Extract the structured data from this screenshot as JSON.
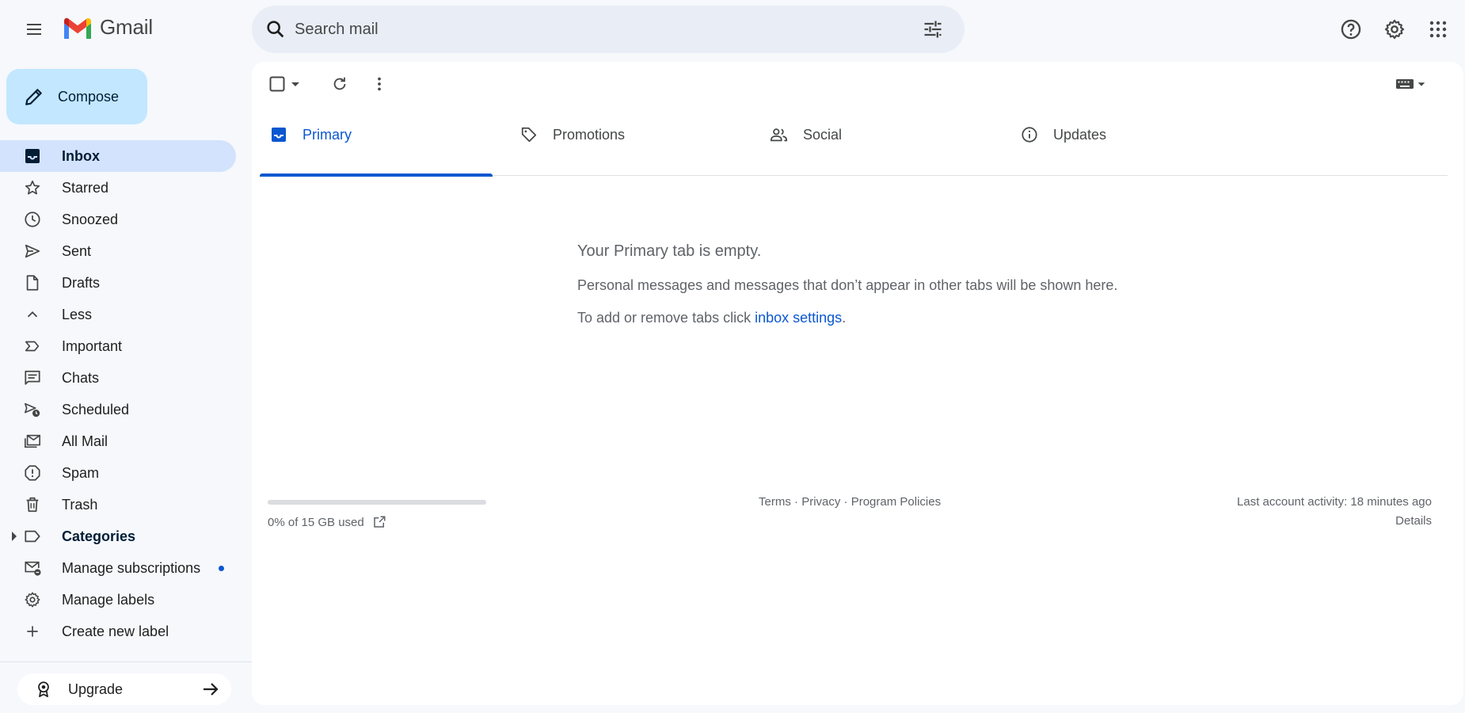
{
  "header": {
    "app_name": "Gmail",
    "search": {
      "placeholder": "Search mail"
    }
  },
  "sidebar": {
    "compose_label": "Compose",
    "items": [
      {
        "label": "Inbox",
        "icon": "inbox-icon",
        "active": true
      },
      {
        "label": "Starred",
        "icon": "star-icon"
      },
      {
        "label": "Snoozed",
        "icon": "clock-icon"
      },
      {
        "label": "Sent",
        "icon": "send-icon"
      },
      {
        "label": "Drafts",
        "icon": "draft-icon"
      },
      {
        "label": "Less",
        "icon": "chevron-up-icon"
      },
      {
        "label": "Important",
        "icon": "important-icon"
      },
      {
        "label": "Chats",
        "icon": "chat-icon"
      },
      {
        "label": "Scheduled",
        "icon": "scheduled-icon"
      },
      {
        "label": "All Mail",
        "icon": "all-mail-icon"
      },
      {
        "label": "Spam",
        "icon": "spam-icon"
      },
      {
        "label": "Trash",
        "icon": "trash-icon"
      },
      {
        "label": "Categories",
        "icon": "label-icon",
        "bold": true
      },
      {
        "label": "Manage subscriptions",
        "icon": "subscriptions-icon"
      },
      {
        "label": "Manage labels",
        "icon": "gear-icon"
      },
      {
        "label": "Create new label",
        "icon": "plus-icon"
      }
    ],
    "upgrade_label": "Upgrade"
  },
  "main": {
    "tabs": [
      {
        "label": "Primary",
        "icon": "inbox-icon",
        "active": true
      },
      {
        "label": "Promotions",
        "icon": "tag-icon"
      },
      {
        "label": "Social",
        "icon": "people-icon"
      },
      {
        "label": "Updates",
        "icon": "info-icon"
      }
    ],
    "empty_state": {
      "title": "Your Primary tab is empty.",
      "description": "Personal messages and messages that don’t appear in other tabs will be shown here.",
      "hint_prefix": "To add or remove tabs click ",
      "hint_link": "inbox settings",
      "hint_suffix": "."
    },
    "footer": {
      "storage_used_fraction": 0,
      "storage_text": "0% of 15 GB used",
      "terms": "Terms",
      "privacy": "Privacy",
      "program_policies": "Program Policies",
      "separator": " · ",
      "last_activity": "Last account activity: 18 minutes ago",
      "details": "Details"
    }
  },
  "colors": {
    "background": "#f6f8fc",
    "compose": "#c2e7ff",
    "active_nav": "#d3e3fd",
    "accent": "#0b57d0"
  }
}
